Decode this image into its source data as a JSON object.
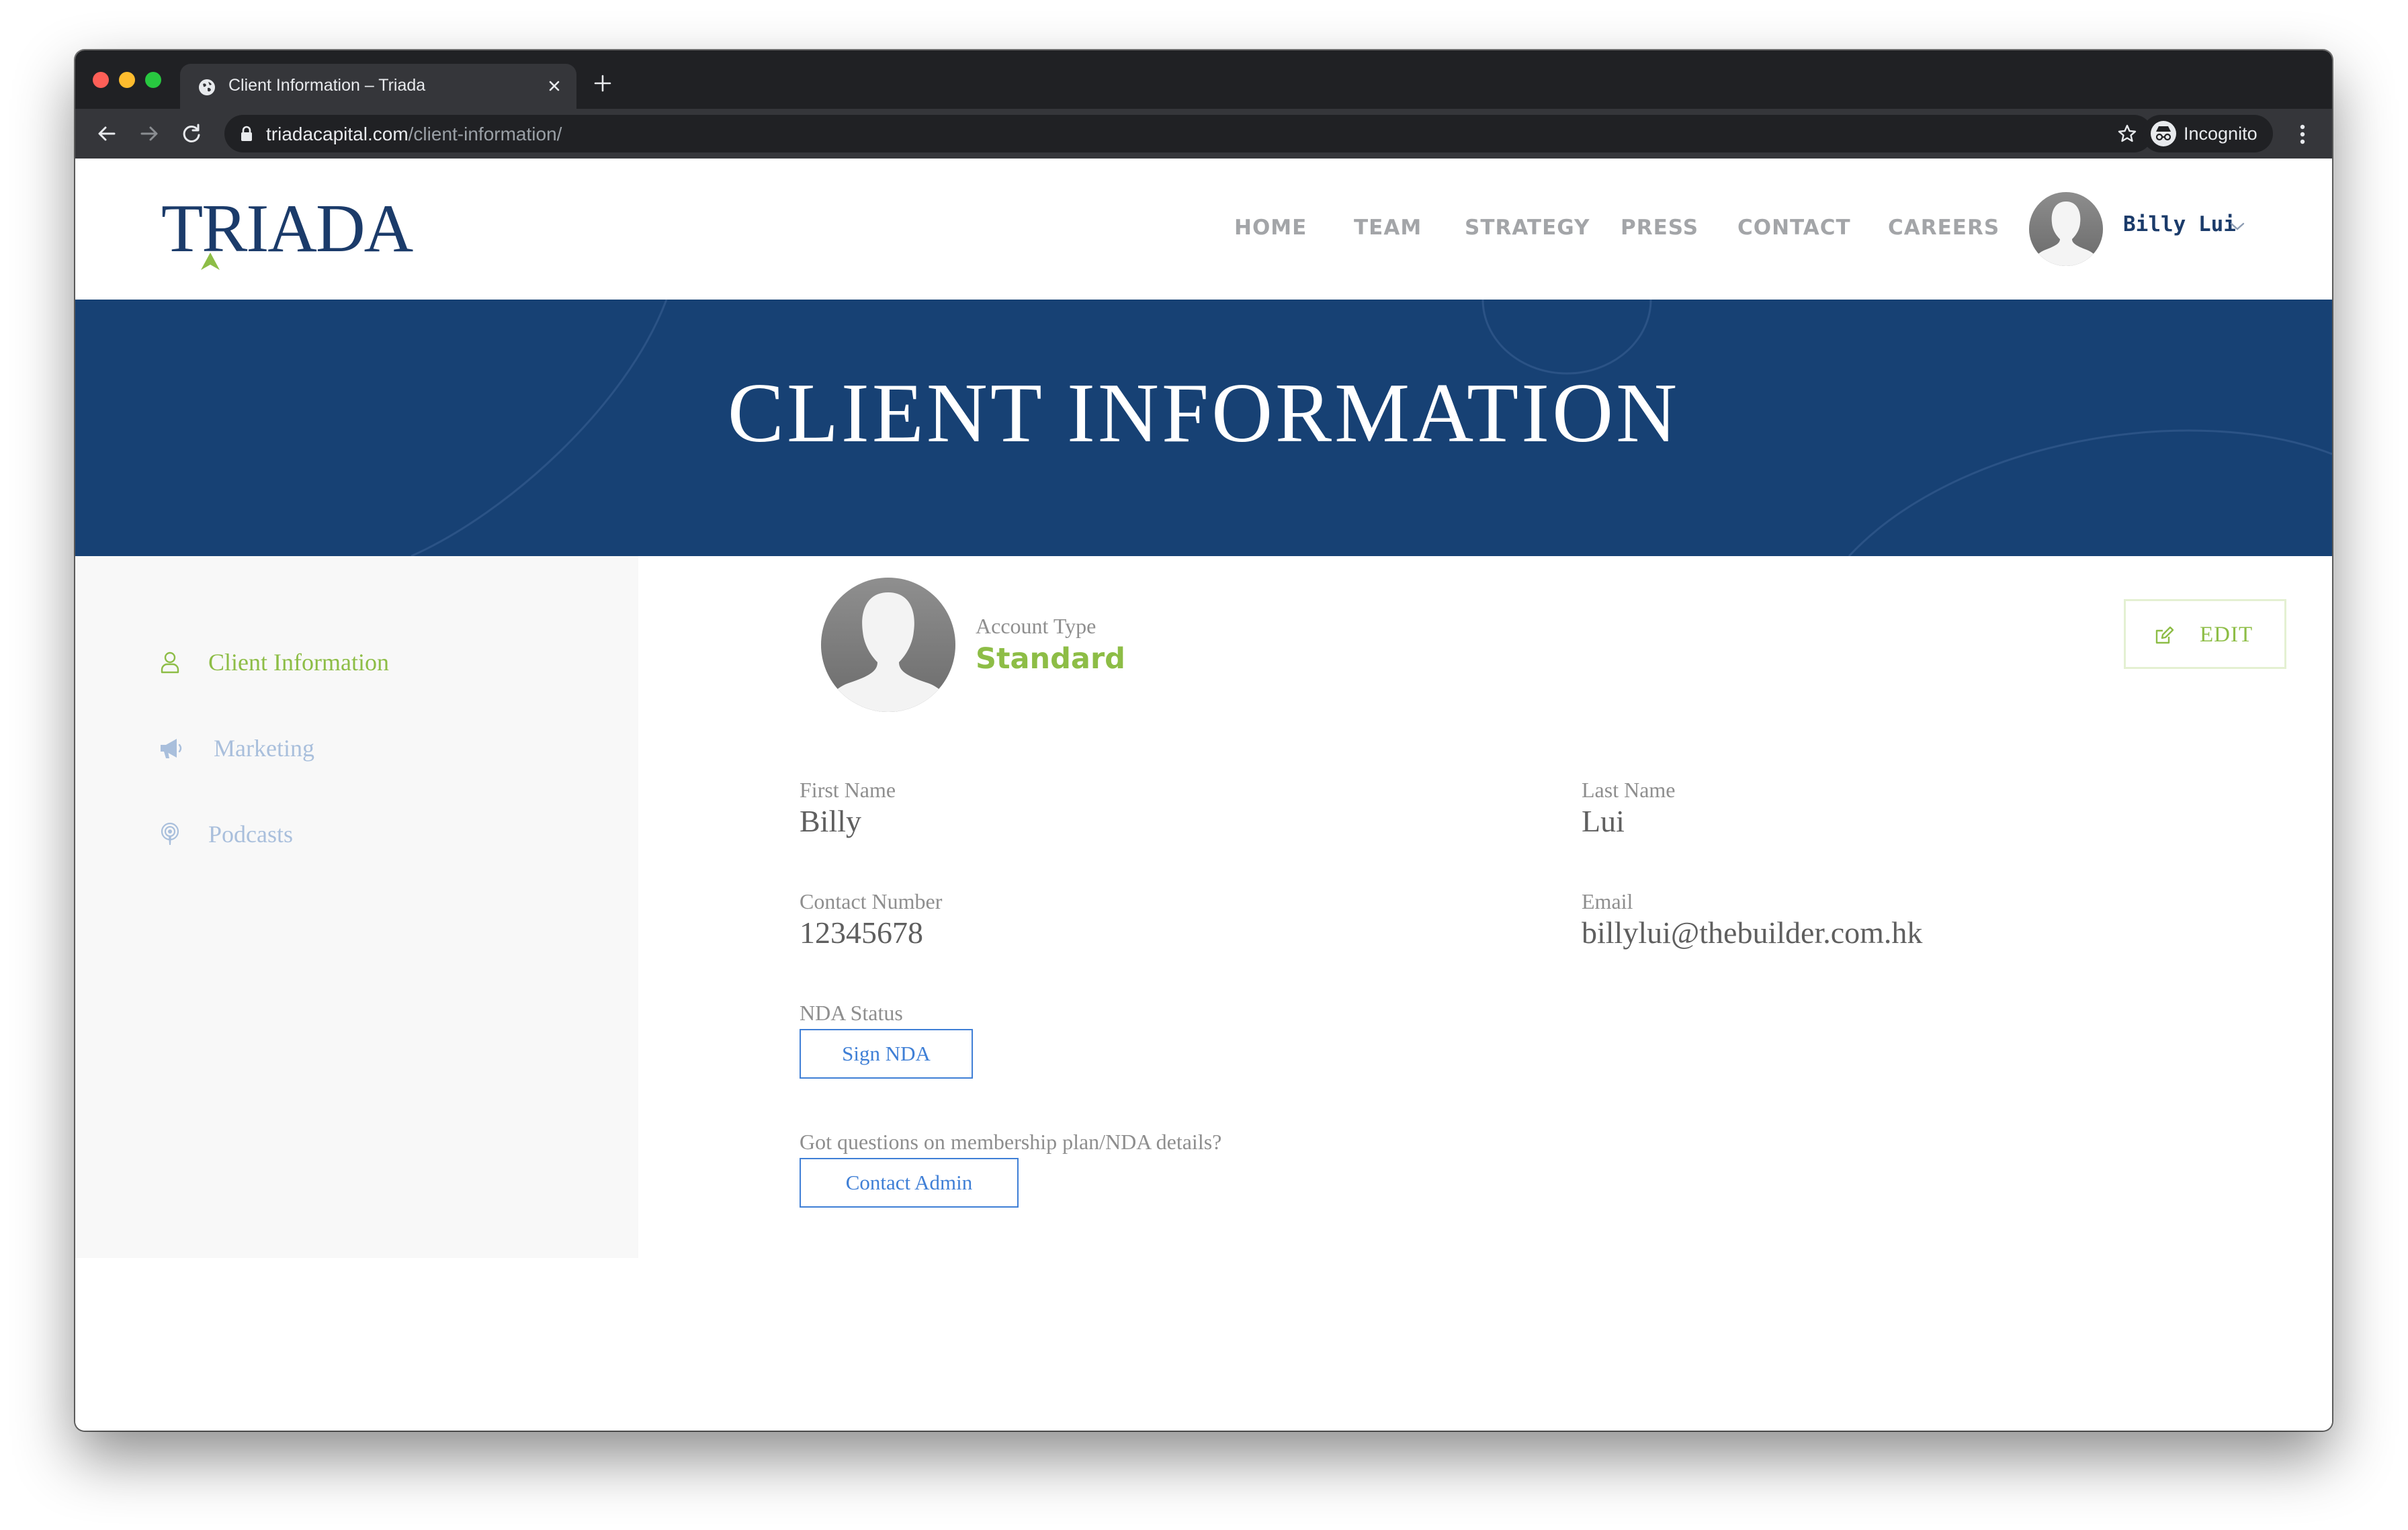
{
  "browser": {
    "tab_title": "Client Information – Triada",
    "url_host": "triadacapital.com",
    "url_path": "/client-information/",
    "incognito_label": "Incognito"
  },
  "header": {
    "logo_text": "TRIADA",
    "nav": [
      {
        "label": "HOME"
      },
      {
        "label": "TEAM"
      },
      {
        "label": "STRATEGY"
      },
      {
        "label": "PRESS"
      },
      {
        "label": "CONTACT"
      },
      {
        "label": "CAREERS"
      }
    ],
    "user_name": "Billy Lui"
  },
  "hero": {
    "title": "CLIENT INFORMATION"
  },
  "sidebar": {
    "items": [
      {
        "label": "Client Information",
        "icon": "user-icon",
        "active": true
      },
      {
        "label": "Marketing",
        "icon": "megaphone-icon",
        "active": false
      },
      {
        "label": "Podcasts",
        "icon": "podcast-icon",
        "active": false
      }
    ]
  },
  "profile": {
    "account_type_label": "Account Type",
    "account_type_value": "Standard",
    "edit_label": "EDIT",
    "first_name_label": "First Name",
    "first_name_value": "Billy",
    "last_name_label": "Last Name",
    "last_name_value": "Lui",
    "contact_number_label": "Contact Number",
    "contact_number_value": "12345678",
    "email_label": "Email",
    "email_value": "billylui@thebuilder.com.hk",
    "nda_status_label": "NDA Status",
    "sign_nda_label": "Sign NDA",
    "questions_text": "Got questions on membership plan/NDA details?",
    "contact_admin_label": "Contact Admin"
  },
  "colors": {
    "brand_navy": "#174174",
    "accent_green": "#8dbd46",
    "link_blue": "#3f7fd6",
    "sidebar_inactive": "#a9bfdc"
  }
}
